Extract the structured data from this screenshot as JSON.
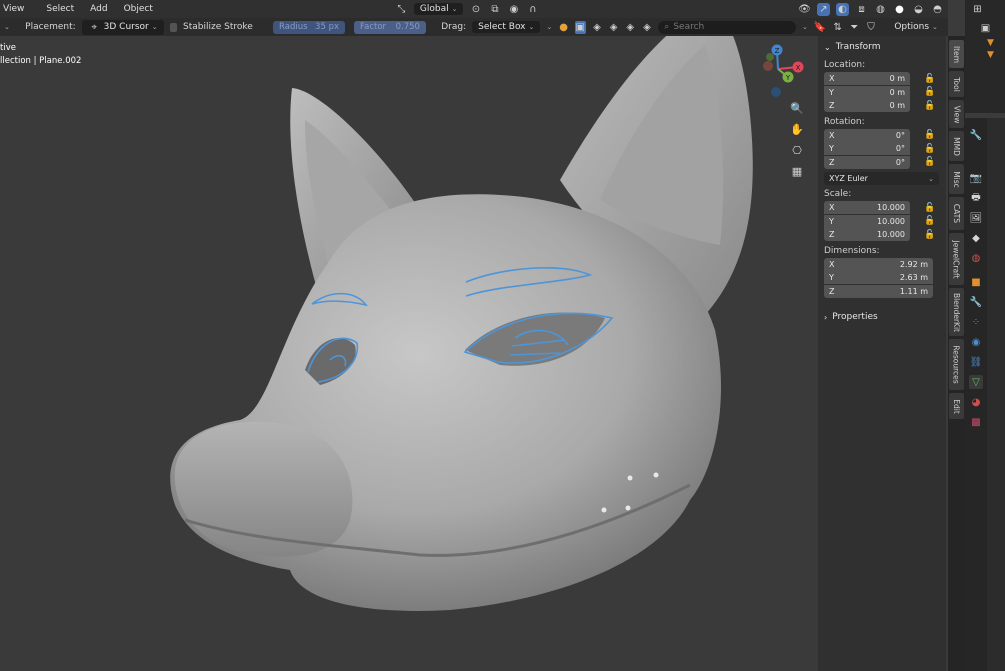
{
  "menubar": {
    "items": [
      "View",
      "Select",
      "Add",
      "Object"
    ],
    "orientation": "Global"
  },
  "toolsettings": {
    "placement_label": "Placement:",
    "placement_value": "3D Cursor",
    "stabilize_label": "Stabilize Stroke",
    "radius_label": "Radius",
    "radius_value": "35 px",
    "factor_label": "Factor",
    "factor_value": "0.750",
    "drag_label": "Drag:",
    "drag_value": "Select Box",
    "search_placeholder": "Search",
    "options_label": "Options"
  },
  "viewport": {
    "overlay_line1": "tive",
    "overlay_line2": "llection | Plane.002",
    "gizmo_axes": [
      "X",
      "Y",
      "Z"
    ]
  },
  "npanel": {
    "title": "Transform",
    "location_label": "Location:",
    "location": [
      {
        "axis": "X",
        "value": "0 m"
      },
      {
        "axis": "Y",
        "value": "0 m"
      },
      {
        "axis": "Z",
        "value": "0 m"
      }
    ],
    "rotation_label": "Rotation:",
    "rotation": [
      {
        "axis": "X",
        "value": "0°"
      },
      {
        "axis": "Y",
        "value": "0°"
      },
      {
        "axis": "Z",
        "value": "0°"
      }
    ],
    "rotation_mode": "XYZ Euler",
    "scale_label": "Scale:",
    "scale": [
      {
        "axis": "X",
        "value": "10.000"
      },
      {
        "axis": "Y",
        "value": "10.000"
      },
      {
        "axis": "Z",
        "value": "10.000"
      }
    ],
    "dimensions_label": "Dimensions:",
    "dimensions": [
      {
        "axis": "X",
        "value": "2.92 m"
      },
      {
        "axis": "Y",
        "value": "2.63 m"
      },
      {
        "axis": "Z",
        "value": "1.11 m"
      }
    ],
    "properties_label": "Properties"
  },
  "sidebar_tabs": [
    "Item",
    "Tool",
    "View",
    "MMD",
    "Misc",
    "CATS",
    "JewelCraft",
    "BlenderKit",
    "Resources",
    "Edit"
  ],
  "colors": {
    "viewport_bg": "#3a3a3a",
    "grease_pencil": "#4d95d8",
    "axis_x": "#e2465b",
    "axis_y": "#7bb043",
    "axis_z": "#3f86d3"
  }
}
